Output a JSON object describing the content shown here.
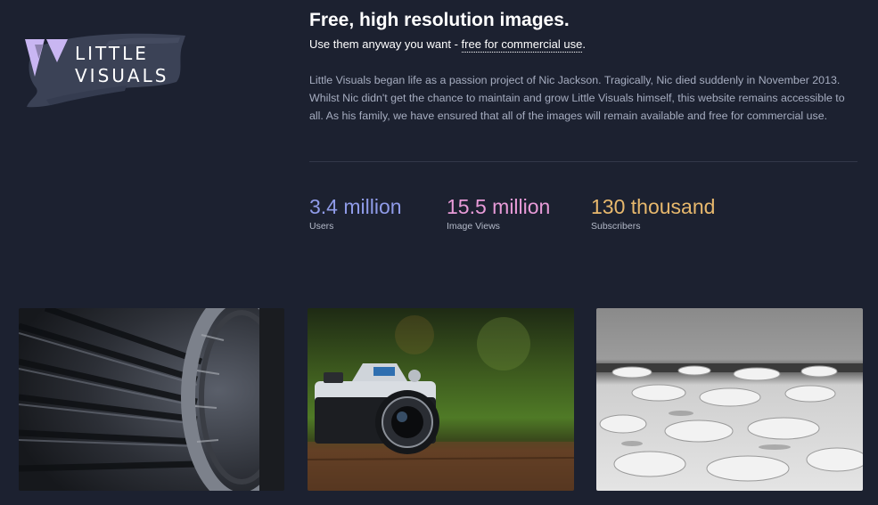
{
  "logo": {
    "line1": "LITTLE",
    "line2": "VISUALS",
    "mark_color": "#c9b6f2",
    "brush_color": "#3b4256"
  },
  "hero": {
    "title": "Free, high resolution images.",
    "subtitle_prefix": "Use them anyway you want - ",
    "subtitle_link": "free for commercial use",
    "subtitle_suffix": ".",
    "description": "Little Visuals began life as a passion project of Nic Jackson. Tragically, Nic died suddenly in November 2013. Whilst Nic didn't get the chance to maintain and grow Little Visuals himself, this website remains accessible to all. As his family, we have ensured that all of the images will remain available and free for commercial use."
  },
  "stats": [
    {
      "value": "3.4 million",
      "label": "Users",
      "color": "#8f9be8"
    },
    {
      "value": "15.5 million",
      "label": "Image Views",
      "color": "#e89bd8"
    },
    {
      "value": "130 thousand",
      "label": "Subscribers",
      "color": "#e7b86d"
    }
  ],
  "photos": [
    {
      "subject": "turbine-engine-photo"
    },
    {
      "subject": "canon-camera-photo"
    },
    {
      "subject": "snowy-beach-photo"
    }
  ],
  "colors": {
    "background": "#1c2130",
    "text_muted": "#a6adc0"
  }
}
